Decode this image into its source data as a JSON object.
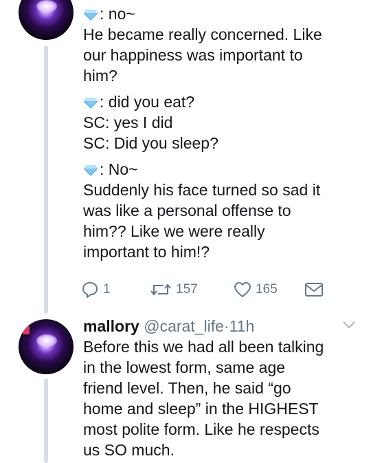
{
  "tweet1": {
    "lines": [
      ": no~",
      "He became really concerned. Like",
      "our happiness was important to",
      "him?",
      ": did you eat?",
      "SC: yes I did",
      "SC: Did you sleep?",
      ": No~",
      "Suddenly his face turned so sad it",
      "was like a personal offense to",
      "him?? Like we were really",
      "important to him!?"
    ],
    "actions": {
      "reply_count": "1",
      "retweet_count": "157",
      "like_count": "165"
    }
  },
  "tweet2": {
    "display_name": "mallory",
    "handle": "@carat_life",
    "separator": "·",
    "time": "11h",
    "lines": [
      "Before this we had all been talking",
      "in the lowest form, same age",
      "friend level. Then, he said “go",
      "home and sleep” in the HIGHEST",
      "most polite form. Like he respects",
      "us SO much."
    ]
  },
  "icons": {
    "speaker": "diamond-icon",
    "reply": "reply-icon",
    "retweet": "retweet-icon",
    "like": "heart-icon",
    "dm": "envelope-icon",
    "more": "chevron-down-icon"
  },
  "colors": {
    "text": "#14171a",
    "muted": "#657786",
    "thread": "#d7dde2",
    "diamond": "#7ec8f2"
  }
}
